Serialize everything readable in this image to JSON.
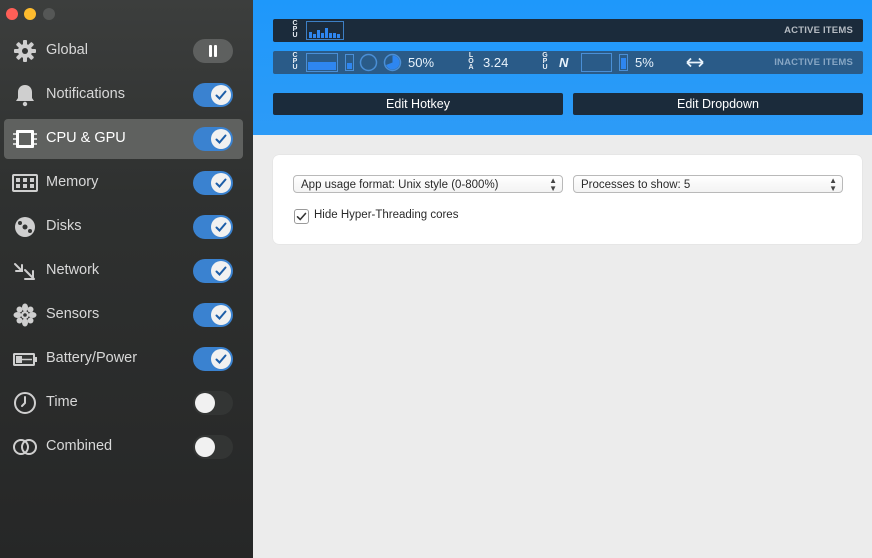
{
  "sidebar": {
    "items": [
      {
        "label": "Global",
        "icon": "gear-icon"
      },
      {
        "label": "Notifications",
        "icon": "bell-icon"
      },
      {
        "label": "CPU & GPU",
        "icon": "cpu-chip-icon"
      },
      {
        "label": "Memory",
        "icon": "memory-module-icon"
      },
      {
        "label": "Disks",
        "icon": "disk-icon"
      },
      {
        "label": "Network",
        "icon": "network-arrows-icon"
      },
      {
        "label": "Sensors",
        "icon": "sensor-fan-icon"
      },
      {
        "label": "Battery/Power",
        "icon": "battery-icon"
      },
      {
        "label": "Time",
        "icon": "clock-icon"
      },
      {
        "label": "Combined",
        "icon": "combined-rings-icon"
      }
    ],
    "selected": "CPU & GPU",
    "toggles": [
      "pause",
      "on",
      "on",
      "on",
      "on",
      "on",
      "on",
      "on",
      "off",
      "off"
    ]
  },
  "banner": {
    "active_label": "ACTIVE ITEMS",
    "inactive_label": "INACTIVE ITEMS",
    "cpu_tag": "CPU",
    "load_tag": "LOA",
    "gpu_tag": "GPU",
    "cpu_percent": "50%",
    "load_value": "3.24",
    "gpu_letter": "N",
    "gpu_percent": "5%",
    "edit_hotkey": "Edit Hotkey",
    "edit_dropdown": "Edit Dropdown"
  },
  "settings": {
    "app_usage_format": "App usage format: Unix style (0-800%)",
    "processes_to_show": "Processes to show: 5",
    "hide_hyperthreading": "Hide Hyper-Threading cores",
    "hide_hyperthreading_checked": true
  },
  "colors": {
    "accent": "#3a82d0",
    "banner": "#1e98fb",
    "sidebar": "#2f3130"
  }
}
